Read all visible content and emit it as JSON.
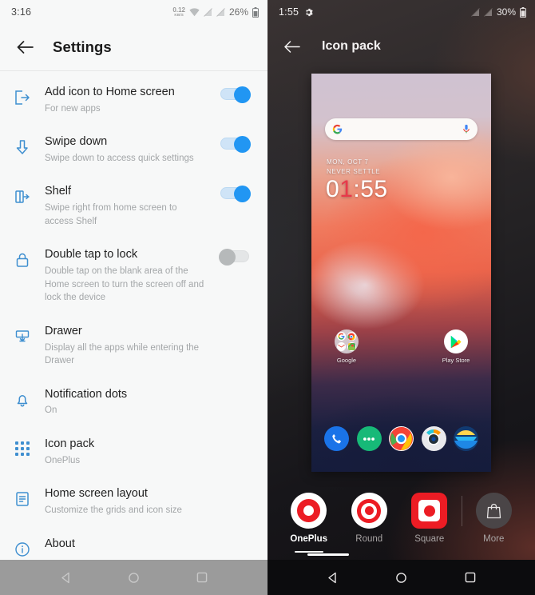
{
  "left_screen": {
    "status_bar": {
      "time": "3:16",
      "net_speed_value": "0.12",
      "net_speed_unit": "KB/S",
      "battery_percent": "26%",
      "icons": [
        "wifi-icon",
        "signal-off-icon",
        "signal-off-icon",
        "battery-icon"
      ]
    },
    "app_bar": {
      "back_icon": "arrow-left-icon",
      "title": "Settings"
    },
    "items": [
      {
        "icon": "export-home-icon",
        "title": "Add icon to Home screen",
        "subtitle": "For new apps",
        "control": "toggle",
        "state": "on"
      },
      {
        "icon": "arrow-down-icon",
        "title": "Swipe down",
        "subtitle": "Swipe down to access quick settings",
        "control": "toggle",
        "state": "on"
      },
      {
        "icon": "shelf-icon",
        "title": "Shelf",
        "subtitle": "Swipe right from home screen to access Shelf",
        "control": "toggle",
        "state": "on"
      },
      {
        "icon": "lock-icon",
        "title": "Double tap to lock",
        "subtitle": "Double tap on the blank area of the Home screen to turn the screen off and lock the device",
        "control": "toggle",
        "state": "off"
      },
      {
        "icon": "drawer-icon",
        "title": "Drawer",
        "subtitle": "Display all the apps while entering the Drawer",
        "control": "none",
        "state": ""
      },
      {
        "icon": "bell-icon",
        "title": "Notification dots",
        "subtitle": "On",
        "control": "none",
        "state": ""
      },
      {
        "icon": "grid-icon",
        "title": "Icon pack",
        "subtitle": "OnePlus",
        "control": "none",
        "state": ""
      },
      {
        "icon": "layout-icon",
        "title": "Home screen layout",
        "subtitle": "Customize the grids and icon size",
        "control": "none",
        "state": ""
      },
      {
        "icon": "info-icon",
        "title": "About",
        "subtitle": "",
        "control": "none",
        "state": ""
      }
    ],
    "nav_bar": {
      "back": "nav-back-icon",
      "home": "nav-home-icon",
      "recents": "nav-recents-icon"
    }
  },
  "right_screen": {
    "status_bar": {
      "time": "1:55",
      "gear_icon": "gear-icon",
      "battery_percent": "30%",
      "icons": [
        "signal-off-icon",
        "signal-off-icon",
        "battery-icon"
      ]
    },
    "app_bar": {
      "back_icon": "arrow-left-icon",
      "title": "Icon pack"
    },
    "preview": {
      "search_placeholder": "",
      "google_logo": "google-g-icon",
      "mic_icon": "microphone-icon",
      "date_line1": "MON, OCT 7",
      "date_line2": "NEVER SETTLE",
      "clock_prefix": "0",
      "clock_red_digit": "1",
      "clock_suffix": ":55",
      "home_apps": [
        {
          "label": "Google",
          "icon": "google-folder-icon"
        },
        {
          "label": "Play Store",
          "icon": "play-store-icon"
        }
      ],
      "dock_apps": [
        {
          "label": "Phone",
          "icon": "phone-icon"
        },
        {
          "label": "Messages",
          "icon": "messages-icon"
        },
        {
          "label": "Chrome",
          "icon": "chrome-icon"
        },
        {
          "label": "Camera",
          "icon": "camera-icon"
        },
        {
          "label": "Weather",
          "icon": "weather-icon"
        }
      ]
    },
    "icon_packs": [
      {
        "label": "OnePlus",
        "icon": "oneplus-pack-icon",
        "selected": true
      },
      {
        "label": "Round",
        "icon": "round-pack-icon",
        "selected": false
      },
      {
        "label": "Square",
        "icon": "square-pack-icon",
        "selected": false
      },
      {
        "label": "More",
        "icon": "shopping-bag-icon",
        "selected": false
      }
    ],
    "nav_bar": {
      "back": "nav-back-icon",
      "home": "nav-home-icon",
      "recents": "nav-recents-icon"
    }
  },
  "colors": {
    "accent_blue": "#2196f3",
    "icon_blue": "#3f8fd0",
    "oneplus_red": "#ec1c24",
    "left_bg": "#f7f8f8"
  }
}
